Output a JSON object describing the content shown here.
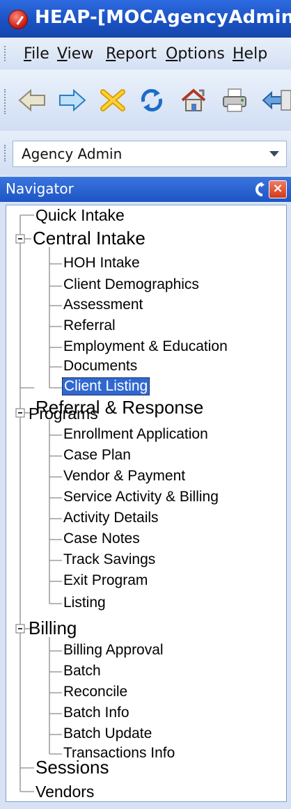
{
  "window": {
    "title": "HEAP-[MOCAgencyAdmin]"
  },
  "menu": [
    {
      "mnemonic": "F",
      "rest": "ile"
    },
    {
      "mnemonic": "V",
      "rest": "iew"
    },
    {
      "mnemonic": "R",
      "rest": "eport"
    },
    {
      "mnemonic": "O",
      "rest": "ptions"
    },
    {
      "mnemonic": "H",
      "rest": "elp"
    }
  ],
  "toolbar": {
    "icons": [
      "back-arrow-icon",
      "forward-arrow-icon",
      "delete-x-icon",
      "refresh-icon",
      "home-icon",
      "print-icon",
      "export-icon"
    ]
  },
  "role_select": {
    "value": "Agency Admin"
  },
  "navigator": {
    "title": "Navigator",
    "close_glyph": "×",
    "tree": {
      "quick_intake": "Quick Intake",
      "central_intake": {
        "label": "Central Intake",
        "children": [
          "HOH Intake",
          "Client Demographics",
          "Assessment",
          "Referral",
          "Employment & Education",
          "Documents",
          "Client Listing"
        ],
        "selected": "Client Listing"
      },
      "referral_response": "Referral & Response",
      "programs": {
        "label": "Programs",
        "children": [
          "Enrollment Application",
          "Case Plan",
          "Vendor & Payment",
          "Service Activity & Billing",
          "Activity Details",
          "Case Notes",
          "Track Savings",
          "Exit Program",
          "Listing"
        ]
      },
      "billing": {
        "label": "Billing",
        "children": [
          "Billing Approval",
          "Batch",
          "Reconcile",
          "Batch Info",
          "Batch Update",
          "Transactions Info"
        ]
      },
      "sessions": "Sessions",
      "vendors": "Vendors",
      "expander_glyph": "−"
    }
  }
}
